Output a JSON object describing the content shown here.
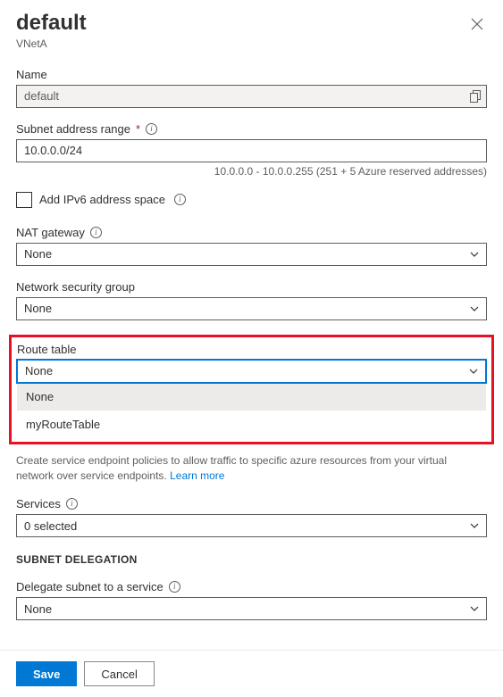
{
  "header": {
    "title": "default",
    "subtitle": "VNetA"
  },
  "name_field": {
    "label": "Name",
    "value": "default"
  },
  "subnet_range": {
    "label": "Subnet address range",
    "value": "10.0.0.0/24",
    "helper": "10.0.0.0 - 10.0.0.255 (251 + 5 Azure reserved addresses)"
  },
  "ipv6": {
    "label": "Add IPv6 address space"
  },
  "nat_gateway": {
    "label": "NAT gateway",
    "value": "None"
  },
  "nsg": {
    "label": "Network security group",
    "value": "None"
  },
  "route_table": {
    "label": "Route table",
    "value": "None",
    "options": [
      "None",
      "myRouteTable"
    ]
  },
  "service_endpoints": {
    "description": "Create service endpoint policies to allow traffic to specific azure resources from your virtual network over service endpoints. ",
    "learn_more": "Learn more"
  },
  "services": {
    "label": "Services",
    "value": "0 selected"
  },
  "subnet_delegation": {
    "section": "SUBNET DELEGATION",
    "label": "Delegate subnet to a service",
    "value": "None"
  },
  "footer": {
    "save": "Save",
    "cancel": "Cancel"
  }
}
